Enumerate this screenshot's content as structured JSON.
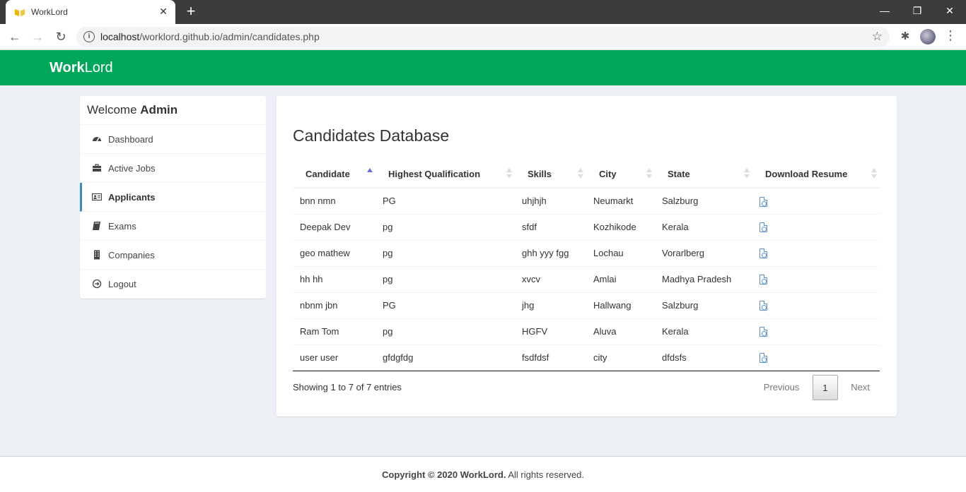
{
  "browser": {
    "tab_title": "WorkLord",
    "url_host": "localhost",
    "url_path": "/worklord.github.io/admin/candidates.php"
  },
  "header": {
    "logo_bold": "Work",
    "logo_rest": "Lord",
    "color": "#00a65a"
  },
  "sidebar": {
    "welcome_prefix": "Welcome",
    "welcome_user": "Admin",
    "items": [
      {
        "label": "Dashboard",
        "icon": "dashboard-icon"
      },
      {
        "label": "Active Jobs",
        "icon": "briefcase-icon"
      },
      {
        "label": "Applicants",
        "icon": "address-card-icon",
        "active": true
      },
      {
        "label": "Exams",
        "icon": "book-icon"
      },
      {
        "label": "Companies",
        "icon": "building-icon"
      },
      {
        "label": "Logout",
        "icon": "sign-out-icon"
      }
    ]
  },
  "main": {
    "title": "Candidates Database",
    "columns": [
      "Candidate",
      "Highest Qualification",
      "Skills",
      "City",
      "State",
      "Download Resume"
    ],
    "rows": [
      {
        "candidate": "bnn nmn",
        "qualification": "PG",
        "skills": "uhjhjh",
        "city": "Neumarkt",
        "state": "Salzburg"
      },
      {
        "candidate": "Deepak Dev",
        "qualification": "pg",
        "skills": "sfdf",
        "city": "Kozhikode",
        "state": "Kerala"
      },
      {
        "candidate": "geo mathew",
        "qualification": "pg",
        "skills": "ghh yyy fgg",
        "city": "Lochau",
        "state": "Vorarlberg"
      },
      {
        "candidate": "hh hh",
        "qualification": "pg",
        "skills": "xvcv",
        "city": "Amlai",
        "state": "Madhya Pradesh"
      },
      {
        "candidate": "nbnm jbn",
        "qualification": "PG",
        "skills": "jhg",
        "city": "Hallwang",
        "state": "Salzburg"
      },
      {
        "candidate": "Ram Tom",
        "qualification": "pg",
        "skills": "HGFV",
        "city": "Aluva",
        "state": "Kerala"
      },
      {
        "candidate": "user user",
        "qualification": "gfdgfdg",
        "skills": "fsdfdsf",
        "city": "city",
        "state": "dfdsfs"
      }
    ],
    "info": "Showing 1 to 7 of 7 entries",
    "pager": {
      "previous": "Previous",
      "current": "1",
      "next": "Next"
    }
  },
  "footer": {
    "copyright": "Copyright © 2020 WorkLord.",
    "rest": " All rights reserved."
  }
}
